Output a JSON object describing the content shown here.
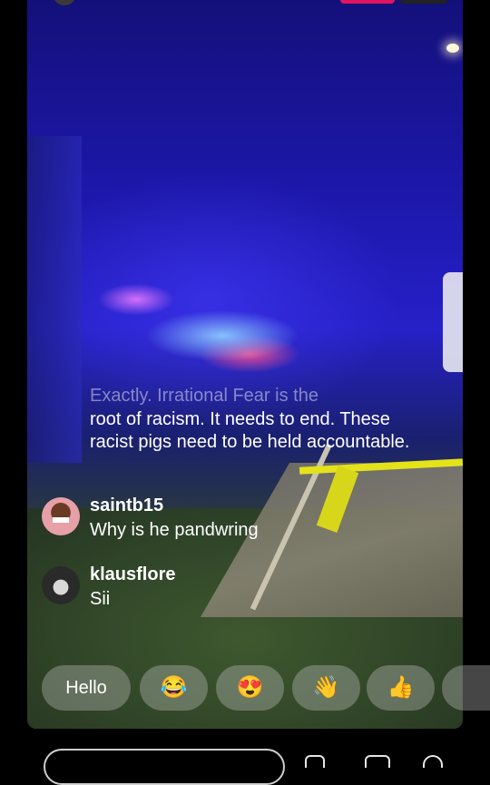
{
  "comments": {
    "fading": {
      "line1": "Exactly. Irrational Fear is the",
      "rest": "root of racism. It needs to end. These racist pigs need to be held accountable."
    },
    "items": [
      {
        "username": "saintb15",
        "message": "Why is he pandwring"
      },
      {
        "username": "klausflore",
        "message": "Sii"
      }
    ]
  },
  "reactions": {
    "hello_label": "Hello",
    "emojis": [
      "😂",
      "😍",
      "👋",
      "👍"
    ]
  },
  "colors": {
    "live_badge": "#e0155f",
    "chip_background": "rgba(200,200,200,0.35)"
  },
  "icons": [
    "avatar",
    "live-badge",
    "viewer-count-badge",
    "comment-input",
    "camera-icon",
    "send-icon",
    "heart-icon"
  ]
}
